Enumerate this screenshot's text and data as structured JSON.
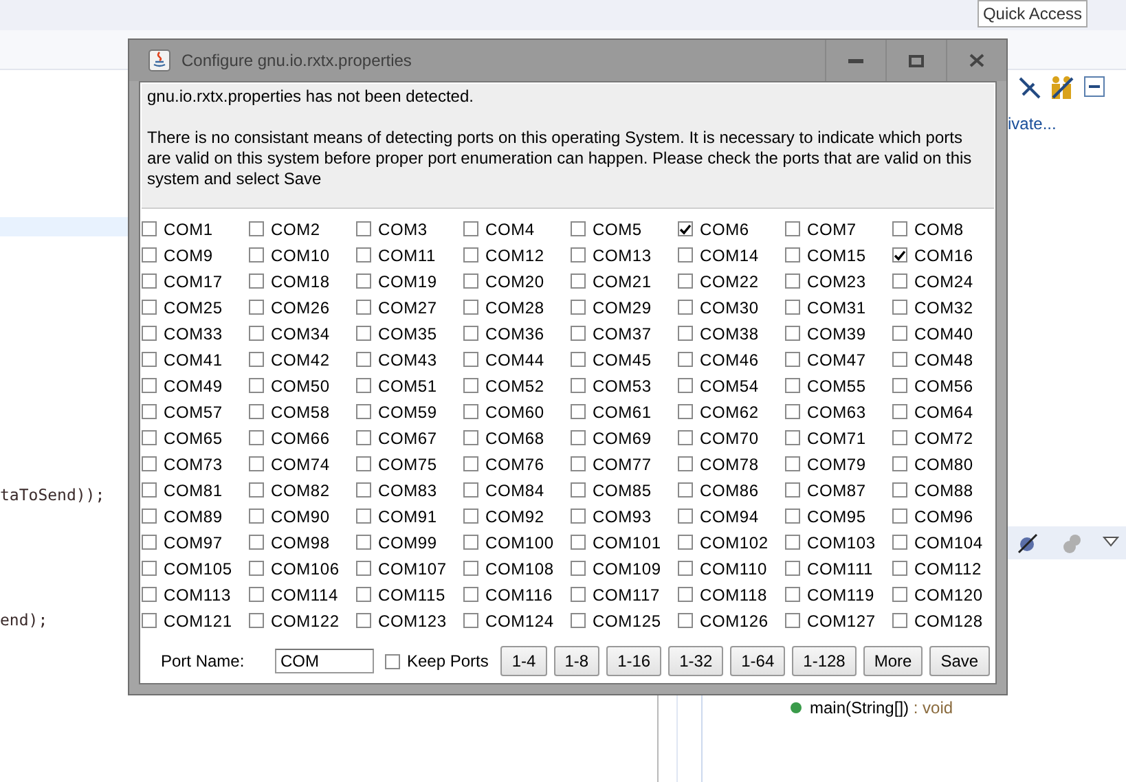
{
  "ide": {
    "quick_access": "Quick Access",
    "link_fragment": "ivate...",
    "code_lines": [
      "taToSend));",
      "end);"
    ],
    "outline_item": "main(String[])",
    "outline_type": " : void"
  },
  "dialog": {
    "title": "Configure gnu.io.rxtx.properties",
    "message": [
      "gnu.io.rxtx.properties has not been detected.",
      "There is no consistant means of detecting ports on this operating System.  It is necessary to indicate which ports are valid on this system before proper port enumeration can happen.  Please check the ports that are valid on this system and select Save"
    ],
    "ports": [
      {
        "label": "COM1",
        "checked": false
      },
      {
        "label": "COM2",
        "checked": false
      },
      {
        "label": "COM3",
        "checked": false
      },
      {
        "label": "COM4",
        "checked": false
      },
      {
        "label": "COM5",
        "checked": false
      },
      {
        "label": "COM6",
        "checked": true
      },
      {
        "label": "COM7",
        "checked": false
      },
      {
        "label": "COM8",
        "checked": false
      },
      {
        "label": "COM9",
        "checked": false
      },
      {
        "label": "COM10",
        "checked": false
      },
      {
        "label": "COM11",
        "checked": false
      },
      {
        "label": "COM12",
        "checked": false
      },
      {
        "label": "COM13",
        "checked": false
      },
      {
        "label": "COM14",
        "checked": false
      },
      {
        "label": "COM15",
        "checked": false
      },
      {
        "label": "COM16",
        "checked": true
      },
      {
        "label": "COM17",
        "checked": false
      },
      {
        "label": "COM18",
        "checked": false
      },
      {
        "label": "COM19",
        "checked": false
      },
      {
        "label": "COM20",
        "checked": false
      },
      {
        "label": "COM21",
        "checked": false
      },
      {
        "label": "COM22",
        "checked": false
      },
      {
        "label": "COM23",
        "checked": false
      },
      {
        "label": "COM24",
        "checked": false
      },
      {
        "label": "COM25",
        "checked": false
      },
      {
        "label": "COM26",
        "checked": false
      },
      {
        "label": "COM27",
        "checked": false
      },
      {
        "label": "COM28",
        "checked": false
      },
      {
        "label": "COM29",
        "checked": false
      },
      {
        "label": "COM30",
        "checked": false
      },
      {
        "label": "COM31",
        "checked": false
      },
      {
        "label": "COM32",
        "checked": false
      },
      {
        "label": "COM33",
        "checked": false
      },
      {
        "label": "COM34",
        "checked": false
      },
      {
        "label": "COM35",
        "checked": false
      },
      {
        "label": "COM36",
        "checked": false
      },
      {
        "label": "COM37",
        "checked": false
      },
      {
        "label": "COM38",
        "checked": false
      },
      {
        "label": "COM39",
        "checked": false
      },
      {
        "label": "COM40",
        "checked": false
      },
      {
        "label": "COM41",
        "checked": false
      },
      {
        "label": "COM42",
        "checked": false
      },
      {
        "label": "COM43",
        "checked": false
      },
      {
        "label": "COM44",
        "checked": false
      },
      {
        "label": "COM45",
        "checked": false
      },
      {
        "label": "COM46",
        "checked": false
      },
      {
        "label": "COM47",
        "checked": false
      },
      {
        "label": "COM48",
        "checked": false
      },
      {
        "label": "COM49",
        "checked": false
      },
      {
        "label": "COM50",
        "checked": false
      },
      {
        "label": "COM51",
        "checked": false
      },
      {
        "label": "COM52",
        "checked": false
      },
      {
        "label": "COM53",
        "checked": false
      },
      {
        "label": "COM54",
        "checked": false
      },
      {
        "label": "COM55",
        "checked": false
      },
      {
        "label": "COM56",
        "checked": false
      },
      {
        "label": "COM57",
        "checked": false
      },
      {
        "label": "COM58",
        "checked": false
      },
      {
        "label": "COM59",
        "checked": false
      },
      {
        "label": "COM60",
        "checked": false
      },
      {
        "label": "COM61",
        "checked": false
      },
      {
        "label": "COM62",
        "checked": false
      },
      {
        "label": "COM63",
        "checked": false
      },
      {
        "label": "COM64",
        "checked": false
      },
      {
        "label": "COM65",
        "checked": false
      },
      {
        "label": "COM66",
        "checked": false
      },
      {
        "label": "COM67",
        "checked": false
      },
      {
        "label": "COM68",
        "checked": false
      },
      {
        "label": "COM69",
        "checked": false
      },
      {
        "label": "COM70",
        "checked": false
      },
      {
        "label": "COM71",
        "checked": false
      },
      {
        "label": "COM72",
        "checked": false
      },
      {
        "label": "COM73",
        "checked": false
      },
      {
        "label": "COM74",
        "checked": false
      },
      {
        "label": "COM75",
        "checked": false
      },
      {
        "label": "COM76",
        "checked": false
      },
      {
        "label": "COM77",
        "checked": false
      },
      {
        "label": "COM78",
        "checked": false
      },
      {
        "label": "COM79",
        "checked": false
      },
      {
        "label": "COM80",
        "checked": false
      },
      {
        "label": "COM81",
        "checked": false
      },
      {
        "label": "COM82",
        "checked": false
      },
      {
        "label": "COM83",
        "checked": false
      },
      {
        "label": "COM84",
        "checked": false
      },
      {
        "label": "COM85",
        "checked": false
      },
      {
        "label": "COM86",
        "checked": false
      },
      {
        "label": "COM87",
        "checked": false
      },
      {
        "label": "COM88",
        "checked": false
      },
      {
        "label": "COM89",
        "checked": false
      },
      {
        "label": "COM90",
        "checked": false
      },
      {
        "label": "COM91",
        "checked": false
      },
      {
        "label": "COM92",
        "checked": false
      },
      {
        "label": "COM93",
        "checked": false
      },
      {
        "label": "COM94",
        "checked": false
      },
      {
        "label": "COM95",
        "checked": false
      },
      {
        "label": "COM96",
        "checked": false
      },
      {
        "label": "COM97",
        "checked": false
      },
      {
        "label": "COM98",
        "checked": false
      },
      {
        "label": "COM99",
        "checked": false
      },
      {
        "label": "COM100",
        "checked": false
      },
      {
        "label": "COM101",
        "checked": false
      },
      {
        "label": "COM102",
        "checked": false
      },
      {
        "label": "COM103",
        "checked": false
      },
      {
        "label": "COM104",
        "checked": false
      },
      {
        "label": "COM105",
        "checked": false
      },
      {
        "label": "COM106",
        "checked": false
      },
      {
        "label": "COM107",
        "checked": false
      },
      {
        "label": "COM108",
        "checked": false
      },
      {
        "label": "COM109",
        "checked": false
      },
      {
        "label": "COM110",
        "checked": false
      },
      {
        "label": "COM111",
        "checked": false
      },
      {
        "label": "COM112",
        "checked": false
      },
      {
        "label": "COM113",
        "checked": false
      },
      {
        "label": "COM114",
        "checked": false
      },
      {
        "label": "COM115",
        "checked": false
      },
      {
        "label": "COM116",
        "checked": false
      },
      {
        "label": "COM117",
        "checked": false
      },
      {
        "label": "COM118",
        "checked": false
      },
      {
        "label": "COM119",
        "checked": false
      },
      {
        "label": "COM120",
        "checked": false
      },
      {
        "label": "COM121",
        "checked": false
      },
      {
        "label": "COM122",
        "checked": false
      },
      {
        "label": "COM123",
        "checked": false
      },
      {
        "label": "COM124",
        "checked": false
      },
      {
        "label": "COM125",
        "checked": false
      },
      {
        "label": "COM126",
        "checked": false
      },
      {
        "label": "COM127",
        "checked": false
      },
      {
        "label": "COM128",
        "checked": false
      }
    ],
    "port_name_label": "Port Name:",
    "port_name_value": "COM",
    "keep_ports": {
      "label": "Keep Ports",
      "checked": false
    },
    "buttons": [
      "1-4",
      "1-8",
      "1-16",
      "1-32",
      "1-64",
      "1-128",
      "More",
      "Save"
    ]
  }
}
